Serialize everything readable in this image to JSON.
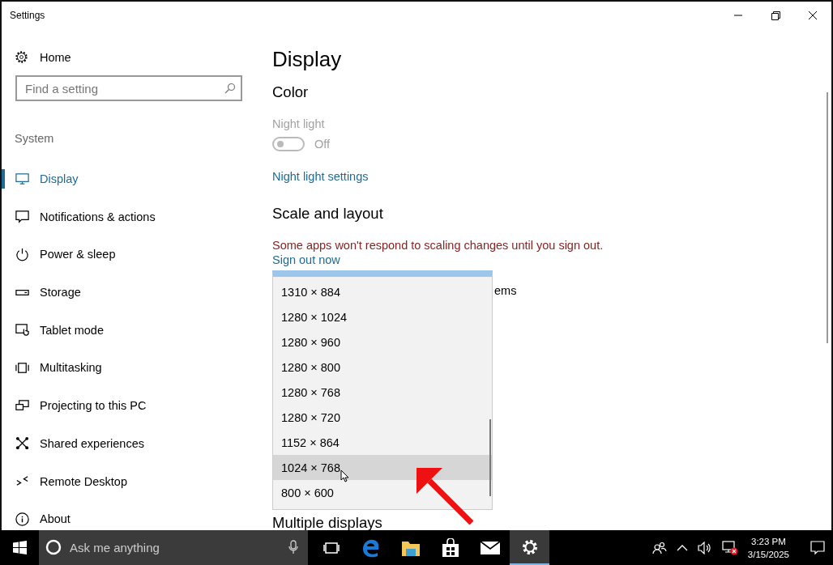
{
  "window": {
    "title": "Settings"
  },
  "sidebar": {
    "home": "Home",
    "search": {
      "placeholder": "Find a setting"
    },
    "section": "System",
    "items": [
      {
        "label": "Display",
        "kind": "monitor",
        "selected": true
      },
      {
        "label": "Notifications & actions",
        "kind": "message",
        "selected": false
      },
      {
        "label": "Power & sleep",
        "kind": "power",
        "selected": false
      },
      {
        "label": "Storage",
        "kind": "drive",
        "selected": false
      },
      {
        "label": "Tablet mode",
        "kind": "tablet",
        "selected": false
      },
      {
        "label": "Multitasking",
        "kind": "multitask",
        "selected": false
      },
      {
        "label": "Projecting to this PC",
        "kind": "project",
        "selected": false
      },
      {
        "label": "Shared experiences",
        "kind": "share",
        "selected": false
      },
      {
        "label": "Remote Desktop",
        "kind": "remote",
        "selected": false
      },
      {
        "label": "About",
        "kind": "info",
        "selected": false
      }
    ]
  },
  "content": {
    "title": "Display",
    "color_heading": "Color",
    "night_light": {
      "label": "Night light",
      "on": false,
      "state": "Off",
      "disabled": true
    },
    "night_light_link": "Night light settings",
    "scale_heading": "Scale and layout",
    "warning": "Some apps won't respond to scaling changes until you sign out.",
    "sign_out_link": "Sign out now",
    "covered_text": "ems",
    "multiple_heading": "Multiple displays"
  },
  "resolution_dropdown": {
    "options": [
      {
        "label": "1310 × 884",
        "selected": false
      },
      {
        "label": "1280 × 1024",
        "selected": false
      },
      {
        "label": "1280 × 960",
        "selected": false
      },
      {
        "label": "1280 × 800",
        "selected": false
      },
      {
        "label": "1280 × 768",
        "selected": false
      },
      {
        "label": "1280 × 720",
        "selected": false
      },
      {
        "label": "1152 × 864",
        "selected": false
      },
      {
        "label": "1024 × 768",
        "selected": true
      },
      {
        "label": "800 × 600",
        "selected": false
      }
    ]
  },
  "taskbar": {
    "search": {
      "placeholder": "Ask me anything"
    },
    "apps": [
      {
        "kind": "task-view",
        "active": false
      },
      {
        "kind": "browser",
        "active": false
      },
      {
        "kind": "folder",
        "active": false
      },
      {
        "kind": "store",
        "active": false
      },
      {
        "kind": "mail",
        "active": false
      },
      {
        "kind": "settings",
        "active": true
      }
    ],
    "time": "3:23 PM",
    "date": "3/15/2025"
  }
}
